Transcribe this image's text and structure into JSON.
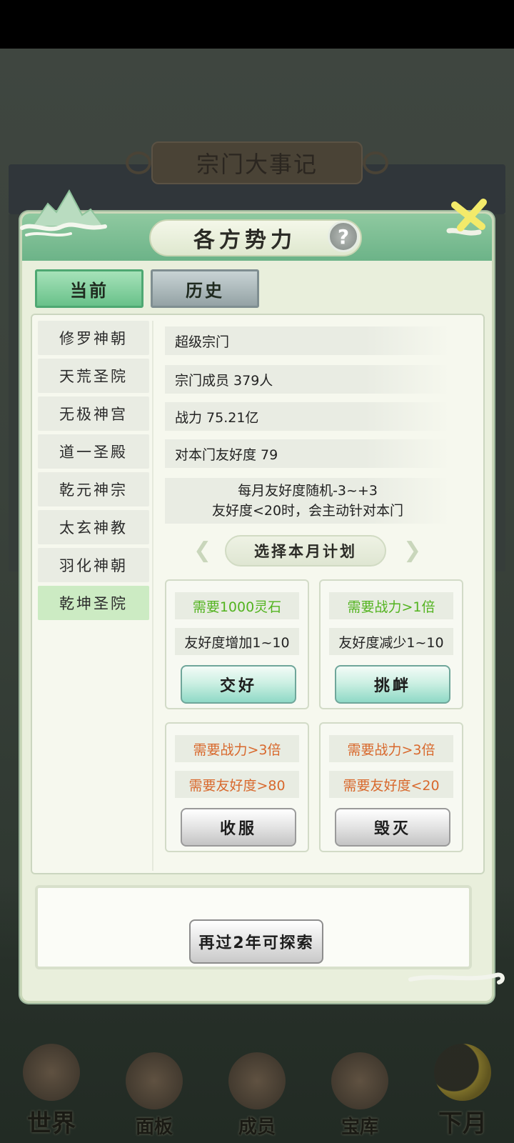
{
  "background": {
    "event_title": "宗门大事记",
    "nav": [
      {
        "label": "世界",
        "icon": "palace-icon"
      },
      {
        "label": "面板",
        "icon": "gate-icon"
      },
      {
        "label": "成员",
        "icon": "member-icon"
      },
      {
        "label": "宝库",
        "icon": "treasury-icon"
      },
      {
        "label": "下月",
        "icon": "moon-icon"
      }
    ]
  },
  "dialog": {
    "title": "各方势力",
    "help_icon": "?",
    "tabs": [
      {
        "label": "当前",
        "active": true
      },
      {
        "label": "历史",
        "active": false
      }
    ],
    "factions": [
      "修罗神朝",
      "天荒圣院",
      "无极神宫",
      "道一圣殿",
      "乾元神宗",
      "太玄神教",
      "羽化神朝",
      "乾坤圣院"
    ],
    "selected_faction": "乾坤圣院",
    "info": {
      "rank": "超级宗门",
      "members": "宗门成员 379人",
      "power": "战力 75.21亿",
      "friendship": "对本门友好度 79",
      "note_line1": "每月友好度随机-3~+3",
      "note_line2": "友好度<20时，会主动针对本门"
    },
    "plan_title": "选择本月计划",
    "plans": [
      {
        "req1": "需要1000灵石",
        "req2": "友好度增加1~10",
        "button": "交好"
      },
      {
        "req1": "需要战力>1倍",
        "req2": "友好度减少1~10",
        "button": "挑衅"
      },
      {
        "req1": "需要战力>3倍",
        "req2": "需要友好度>80",
        "button": "收服"
      },
      {
        "req1": "需要战力>3倍",
        "req2": "需要友好度<20",
        "button": "毁灭"
      }
    ],
    "explore_button": "再过2年可探索"
  },
  "colors": {
    "green_text": "#52b31f",
    "orange_text": "#d8682c",
    "header_green": "#6cb388"
  }
}
